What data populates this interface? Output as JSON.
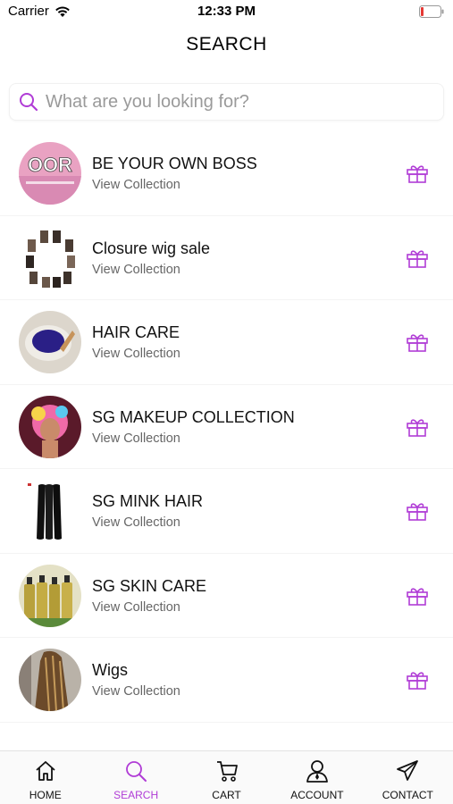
{
  "status_bar": {
    "carrier": "Carrier",
    "time": "12:33 PM"
  },
  "header": {
    "title": "SEARCH"
  },
  "search": {
    "placeholder": "What are you looking for?",
    "value": ""
  },
  "collections": [
    {
      "title": "BE YOUR OWN BOSS",
      "subtitle": "View Collection",
      "thumb_text": "OOR"
    },
    {
      "title": "Closure wig sale",
      "subtitle": "View Collection"
    },
    {
      "title": "HAIR CARE",
      "subtitle": "View Collection"
    },
    {
      "title": "SG MAKEUP COLLECTION",
      "subtitle": "View Collection"
    },
    {
      "title": "SG MINK HAIR",
      "subtitle": "View Collection"
    },
    {
      "title": "SG SKIN CARE",
      "subtitle": "View Collection"
    },
    {
      "title": "Wigs",
      "subtitle": "View Collection"
    }
  ],
  "tabs": [
    {
      "label": "HOME",
      "icon": "home-icon"
    },
    {
      "label": "SEARCH",
      "icon": "search-icon",
      "active": true
    },
    {
      "label": "CART",
      "icon": "cart-icon"
    },
    {
      "label": "ACCOUNT",
      "icon": "account-icon"
    },
    {
      "label": "CONTACT",
      "icon": "send-icon"
    }
  ],
  "colors": {
    "accent": "#b03cd6",
    "text": "#111111",
    "subtext": "#666666"
  }
}
